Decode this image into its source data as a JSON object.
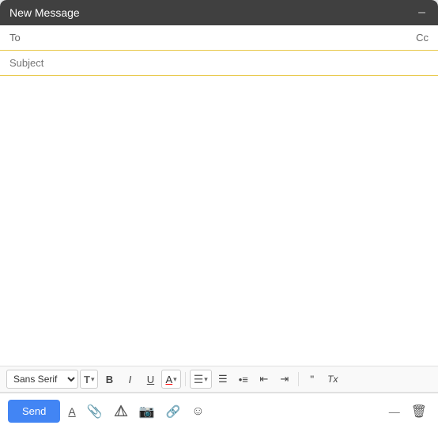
{
  "header": {
    "title": "New Message",
    "minimize_label": "–",
    "close_label": "×"
  },
  "to_field": {
    "label": "To",
    "placeholder": "",
    "cc_label": "Cc"
  },
  "subject_field": {
    "label": "Subject",
    "placeholder": "Subject"
  },
  "body": {
    "placeholder": ""
  },
  "formatting": {
    "font_family": "Sans Serif",
    "font_size_icon": "T",
    "bold": "B",
    "italic": "I",
    "underline": "U",
    "text_color": "A",
    "align": "≡",
    "numbered_list": "≡",
    "bullet_list": "≡",
    "indent_less": "≡",
    "indent_more": "≡",
    "quote": "❝",
    "remove_format": "Tx"
  },
  "bottom_bar": {
    "send_label": "Send",
    "format_icon": "A",
    "attach_icon": "📎",
    "drive_icon": "△",
    "photo_icon": "📷",
    "link_icon": "🔗",
    "emoji_icon": "☺",
    "minimize_icon": "–",
    "delete_icon": "🗑"
  }
}
